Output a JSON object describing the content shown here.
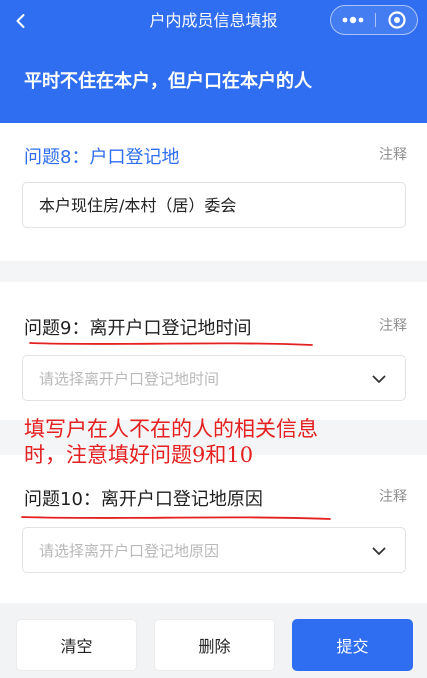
{
  "nav": {
    "title": "户内成员信息填报",
    "back_icon": "chevron-left-icon",
    "more_icon": "more-dots-icon",
    "close_icon": "target-close-icon"
  },
  "section": {
    "heading": "平时不住在本户，但户口在本户的人"
  },
  "questions": [
    {
      "title": "问题8：户口登记地",
      "note": "注释",
      "value": "本户现住房/本村（居）委会"
    },
    {
      "title": "问题9：离开户口登记地时间",
      "note": "注释",
      "placeholder": "请选择离开户口登记地时间"
    },
    {
      "title": "问题10：离开户口登记地原因",
      "note": "注释",
      "placeholder": "请选择离开户口登记地原因"
    }
  ],
  "annotation": {
    "line1": "填写户在人不在的人的相关信息",
    "line2": "时，注意填好问题9和10",
    "color": "#e42020"
  },
  "footer": {
    "clear_label": "清空",
    "delete_label": "删除",
    "submit_label": "提交"
  },
  "colors": {
    "primary": "#2f6ef0",
    "background": "#f4f5f7",
    "annotation": "#e42020"
  }
}
